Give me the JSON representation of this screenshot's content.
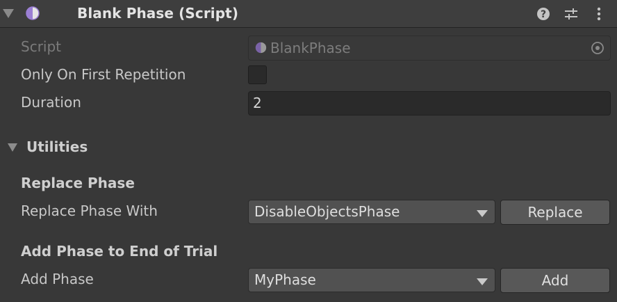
{
  "header": {
    "title": "Blank Phase (Script)",
    "icons": {
      "foldout": "triangle-down-icon",
      "script": "script-icon",
      "help": "help-icon",
      "presets": "presets-icon",
      "menu": "kebab-menu-icon"
    }
  },
  "fields": {
    "script": {
      "label": "Script",
      "value": "BlankPhase"
    },
    "only_first": {
      "label": "Only On First Repetition",
      "checked": false
    },
    "duration": {
      "label": "Duration",
      "value": "2"
    }
  },
  "utilities": {
    "label": "Utilities",
    "expanded": true,
    "replace_section": {
      "title": "Replace Phase",
      "label": "Replace Phase With",
      "selected": "DisableObjectsPhase",
      "button": "Replace"
    },
    "add_section": {
      "title": "Add Phase to End of Trial",
      "label": "Add Phase",
      "selected": "MyPhase",
      "button": "Add"
    }
  },
  "colors": {
    "background": "#383838",
    "header": "#3e3e3e",
    "script_icon": "#9b7fd4",
    "field": "#2a2a2a",
    "button": "#585858"
  }
}
